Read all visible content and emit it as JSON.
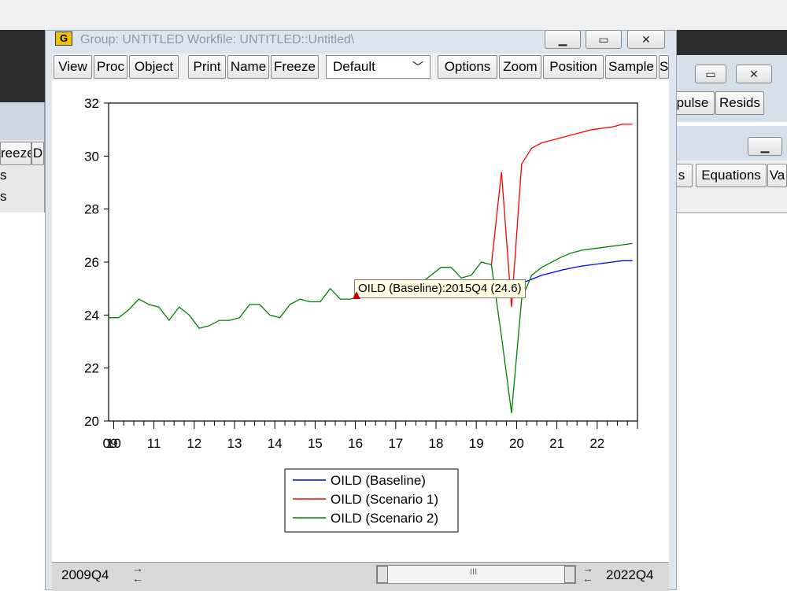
{
  "window": {
    "icon_letter": "G",
    "title": "Group: UNTITLED   Workfile: UNTITLED::Untitled\\"
  },
  "toolbar": {
    "buttons": [
      "View",
      "Proc",
      "Object",
      "Print",
      "Name",
      "Freeze"
    ],
    "dropdown_value": "Default",
    "buttons_right": [
      "Options",
      "Zoom",
      "Position",
      "Sample",
      "S"
    ]
  },
  "background_windows": {
    "left_button": "reeze",
    "left_button_partial": "D",
    "left_lines": [
      "s",
      "s"
    ],
    "right_upper_buttons": [
      "pulse",
      "Resids"
    ],
    "right_lower_buttons": [
      "s",
      "Equations",
      "Va"
    ]
  },
  "tooltip": "OILD (Baseline):2015Q4  (24.6)",
  "range": {
    "start": "2009Q4",
    "end": "2022Q4",
    "scroll_thumb": "III"
  },
  "chart_data": {
    "type": "line",
    "ylim": [
      20,
      32
    ],
    "yticks": [
      20,
      22,
      24,
      26,
      28,
      30,
      32
    ],
    "xlim": [
      2009.875,
      2023.0
    ],
    "xtick_labels": [
      "09",
      "10",
      "11",
      "12",
      "13",
      "14",
      "15",
      "16",
      "17",
      "18",
      "19",
      "20",
      "21",
      "22"
    ],
    "legend_placement": "bottom-center",
    "colors": {
      "baseline": "#0000ff",
      "scenario1": "#ff0000",
      "scenario2": "#008000"
    },
    "series": [
      {
        "name": "OILD (Baseline)",
        "color": "#0000ff",
        "x": [
          2020.125,
          2020.375,
          2020.625,
          2020.875,
          2021.125,
          2021.375,
          2021.625,
          2021.875,
          2022.125,
          2022.375,
          2022.625,
          2022.875
        ],
        "values": [
          25.2,
          25.35,
          25.5,
          25.6,
          25.7,
          25.78,
          25.85,
          25.9,
          25.95,
          26.0,
          26.05,
          26.05
        ]
      },
      {
        "name": "OILD (Scenario 1)",
        "color": "#ff0000",
        "x": [
          2019.375,
          2019.625,
          2019.875,
          2020.125,
          2020.375,
          2020.625,
          2020.875,
          2021.125,
          2021.375,
          2021.625,
          2021.875,
          2022.125,
          2022.375,
          2022.625,
          2022.875
        ],
        "values": [
          25.9,
          29.4,
          24.3,
          29.7,
          30.3,
          30.5,
          30.6,
          30.7,
          30.8,
          30.9,
          31.0,
          31.05,
          31.1,
          31.2,
          31.2
        ],
        "style": "partly hidden behind scenario 2 before 2019Q3"
      },
      {
        "name": "OILD (Scenario 2)",
        "color": "#008000",
        "x": [
          2009.875,
          2010.125,
          2010.375,
          2010.625,
          2010.875,
          2011.125,
          2011.375,
          2011.625,
          2011.875,
          2012.125,
          2012.375,
          2012.625,
          2012.875,
          2013.125,
          2013.375,
          2013.625,
          2013.875,
          2014.125,
          2014.375,
          2014.625,
          2014.875,
          2015.125,
          2015.375,
          2015.625,
          2015.875,
          2016.125,
          2016.375,
          2016.625,
          2016.875,
          2017.125,
          2017.375,
          2017.625,
          2017.875,
          2018.125,
          2018.375,
          2018.625,
          2018.875,
          2019.125,
          2019.375,
          2019.625,
          2019.875,
          2020.125,
          2020.375,
          2020.625,
          2020.875,
          2021.125,
          2021.375,
          2021.625,
          2021.875,
          2022.125,
          2022.375,
          2022.625,
          2022.875
        ],
        "values": [
          23.9,
          23.9,
          24.2,
          24.6,
          24.4,
          24.3,
          23.8,
          24.3,
          24.0,
          23.5,
          23.6,
          23.8,
          23.8,
          23.9,
          24.4,
          24.4,
          24.0,
          23.9,
          24.4,
          24.6,
          24.5,
          24.5,
          25.0,
          24.6,
          24.6,
          24.7,
          24.9,
          24.8,
          24.8,
          24.9,
          25.0,
          25.2,
          25.5,
          25.8,
          25.8,
          25.4,
          25.5,
          26.0,
          25.9,
          23.2,
          20.3,
          24.6,
          25.5,
          25.8,
          26.0,
          26.2,
          26.35,
          26.45,
          26.5,
          26.55,
          26.6,
          26.65,
          26.7
        ]
      }
    ]
  }
}
